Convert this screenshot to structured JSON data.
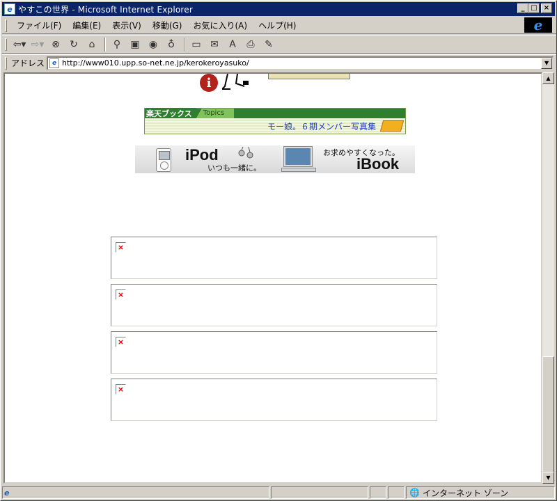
{
  "window": {
    "title": "やすこの世界 - Microsoft Internet Explorer",
    "min_label": "_",
    "max_label": "□",
    "close_label": "×"
  },
  "menu": [
    "ファイル(F)",
    "編集(E)",
    "表示(V)",
    "移動(G)",
    "お気に入り(A)",
    "ヘルプ(H)"
  ],
  "toolbar_icons": [
    "back-icon",
    "forward-icon",
    "stop-icon",
    "refresh-icon",
    "home-icon",
    "search-icon",
    "favorites-icon",
    "media-icon",
    "history-icon",
    "fullscreen-icon",
    "mail-icon",
    "font-icon",
    "print-icon",
    "edit-icon"
  ],
  "address": {
    "label": "アドレス",
    "url": "http://www010.upp.so-net.ne.jp/kerokeroyasuko/"
  },
  "content": {
    "rakuten": {
      "brand": "楽天ブックス",
      "topics": "Topics",
      "headline": "モー娘。６期メンバー写真集"
    },
    "apple": {
      "ipod_title": "iPod",
      "ipod_sub": "いつも一緒に。",
      "ibook_sub": "お求めやすくなった。",
      "ibook_title": "iBook"
    },
    "broken_image_count": 4
  },
  "status": {
    "zone": "インターネット ゾーン"
  }
}
